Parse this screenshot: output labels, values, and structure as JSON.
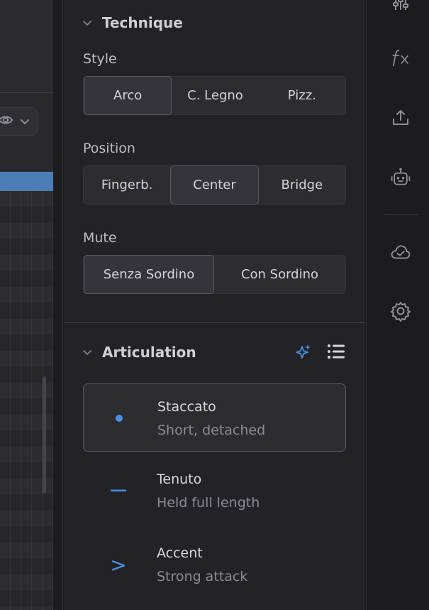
{
  "technique": {
    "title": "Technique",
    "style": {
      "label": "Style",
      "options": [
        "Arco",
        "C. Legno",
        "Pizz."
      ],
      "selected": "Arco"
    },
    "position": {
      "label": "Position",
      "options": [
        "Fingerb.",
        "Center",
        "Bridge"
      ],
      "selected": "Center"
    },
    "mute": {
      "label": "Mute",
      "options": [
        "Senza Sordino",
        "Con Sordino"
      ],
      "selected": "Senza Sordino"
    }
  },
  "articulation": {
    "title": "Articulation",
    "items": [
      {
        "name": "Staccato",
        "desc": "Short, detached",
        "symbol": "dot-icon",
        "selected": true
      },
      {
        "name": "Tenuto",
        "desc": "Held full length",
        "symbol": "dash-icon",
        "selected": false
      },
      {
        "name": "Accent",
        "desc": "Strong attack",
        "symbol": ">",
        "selected": false
      }
    ]
  },
  "rail_icons": [
    "mixer-icon",
    "fx-icon",
    "export-icon",
    "robot-icon",
    "cloud-check-icon",
    "settings-gear-icon"
  ],
  "colors": {
    "accent": "#4a90e2",
    "panel": "#232327",
    "selected_border": "#5a5a60"
  }
}
